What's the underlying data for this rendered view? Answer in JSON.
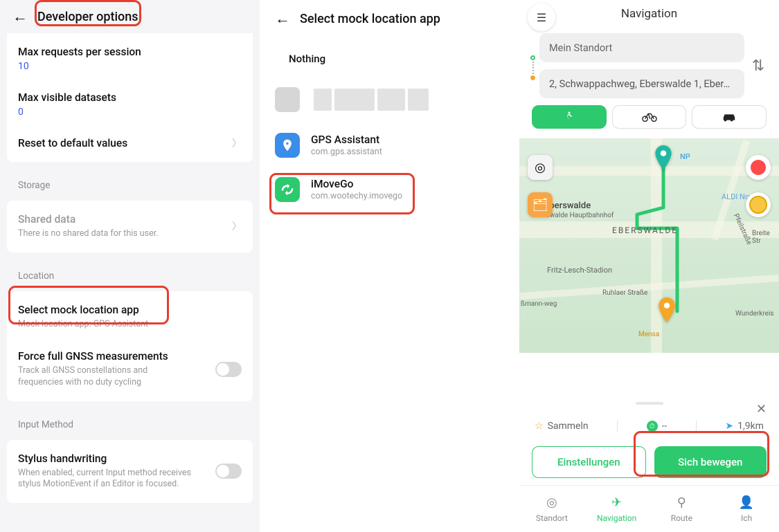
{
  "screen1": {
    "header": "Developer options",
    "max_requests_label": "Max requests per session",
    "max_requests_val": "10",
    "max_datasets_label": "Max visible datasets",
    "max_datasets_val": "0",
    "reset_label": "Reset to default values",
    "storage_section": "Storage",
    "shared_data_title": "Shared data",
    "shared_data_sub": "There is no shared data for this user.",
    "location_section": "Location",
    "select_mock_title": "Select mock location app",
    "select_mock_sub": "Mock location app: GPS Assistant",
    "gnss_title": "Force full GNSS measurements",
    "gnss_sub": "Track all GNSS constellations and frequencies with no duty cycling",
    "input_section": "Input Method",
    "stylus_title": "Stylus handwriting",
    "stylus_sub": "When enabled, current Input method receives stylus MotionEvent if an Editor is focused."
  },
  "screen2": {
    "header": "Select mock location app",
    "nothing": "Nothing",
    "apps": [
      {
        "name": "GPS Assistant",
        "pkg": "com.gps.assistant",
        "icon": "blue"
      },
      {
        "name": "iMoveGo",
        "pkg": "com.wootechy.imovego",
        "icon": "green"
      }
    ]
  },
  "screen3": {
    "title": "Navigation",
    "from_label": "Mein Standort",
    "to_label": "2, Schwappachweg, Eberswalde 1, Eber…",
    "collect": "Sammeln",
    "time_dash": "--",
    "distance": "1,9km",
    "btn_settings": "Einstellungen",
    "btn_move": "Sich bewegen",
    "tabs": [
      {
        "label": "Standort",
        "icon": "◎"
      },
      {
        "label": "Navigation",
        "icon": "➤"
      },
      {
        "label": "Route",
        "icon": "⚑"
      },
      {
        "label": "Ich",
        "icon": "👤"
      }
    ],
    "map_labels": {
      "eberswalde": "Eberswalde",
      "hbf": "erswalde Hauptbahnhof",
      "eberswalde_big": "EBERSWALDE",
      "stadion": "Fritz-Lesch-Stadion",
      "ruhlauer": "Ruhlaer Straße",
      "bmann": "ßmann-weg",
      "aldi": "ALDI Nord",
      "np": "NP",
      "wunder": "Wunderkreis",
      "pfeil": "Pfeilstraße",
      "breite": "Breite Str",
      "mensa": "Mensa"
    }
  }
}
